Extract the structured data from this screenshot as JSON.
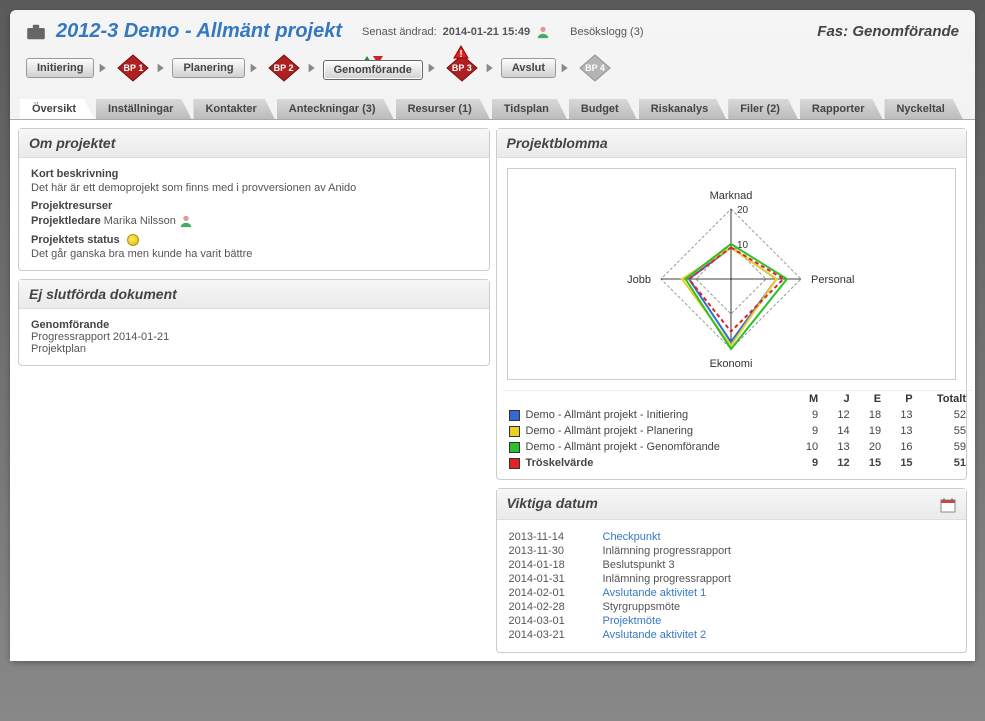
{
  "header": {
    "title": "2012-3 Demo - Allmänt projekt",
    "last_modified_label": "Senast ändrad:",
    "last_modified_value": "2014-01-21 15:49",
    "visit_log": "Besökslogg (3)",
    "phase_label": "Fas:",
    "phase_value": "Genomförande"
  },
  "workflow": {
    "stages": [
      "Initiering",
      "Planering",
      "Genomförande",
      "Avslut"
    ],
    "bps": [
      "BP 1",
      "BP 2",
      "BP 3",
      "BP 4"
    ]
  },
  "tabs": [
    "Översikt",
    "Inställningar",
    "Kontakter",
    "Anteckningar (3)",
    "Resurser (1)",
    "Tidsplan",
    "Budget",
    "Riskanalys",
    "Filer (2)",
    "Rapporter",
    "Nyckeltal"
  ],
  "about": {
    "title": "Om projektet",
    "desc_label": "Kort beskrivning",
    "desc_text": "Det här är ett demoprojekt som finns med i provversionen av Anido",
    "resources_label": "Projektresurser",
    "leader_label": "Projektledare",
    "leader_name": "Marika Nilsson",
    "status_label": "Projektets status",
    "status_text": "Det går ganska bra men kunde ha varit bättre"
  },
  "unfinished": {
    "title": "Ej slutförda dokument",
    "group": "Genomförande",
    "docs": [
      "Progressrapport 2014-01-21",
      "Projektplan"
    ]
  },
  "radar": {
    "title": "Projektblomma",
    "axes": [
      "Marknad",
      "Personal",
      "Ekonomi",
      "Jobb"
    ],
    "ticks": [
      "10",
      "20"
    ]
  },
  "legend": {
    "cols": [
      "M",
      "J",
      "E",
      "P",
      "Totalt"
    ],
    "rows": [
      {
        "color": "#2f6bd1",
        "label": "Demo - Allmänt projekt - Initiering",
        "vals": [
          "9",
          "12",
          "18",
          "13",
          "52"
        ],
        "bold": false
      },
      {
        "color": "#e9cf28",
        "label": "Demo - Allmänt projekt - Planering",
        "vals": [
          "9",
          "14",
          "19",
          "13",
          "55"
        ],
        "bold": false
      },
      {
        "color": "#2bbf2b",
        "label": "Demo - Allmänt projekt - Genomförande",
        "vals": [
          "10",
          "13",
          "20",
          "16",
          "59"
        ],
        "bold": false
      },
      {
        "color": "#e02424",
        "label": "Tröskelvärde",
        "vals": [
          "9",
          "12",
          "15",
          "15",
          "51"
        ],
        "bold": true
      }
    ]
  },
  "dates": {
    "title": "Viktiga datum",
    "items": [
      {
        "date": "2013-11-14",
        "label": "Checkpunkt",
        "link": true
      },
      {
        "date": "2013-11-30",
        "label": "Inlämning progressrapport",
        "link": false
      },
      {
        "date": "2014-01-18",
        "label": "Beslutspunkt 3",
        "link": false
      },
      {
        "date": "2014-01-31",
        "label": "Inlämning progressrapport",
        "link": false
      },
      {
        "date": "2014-02-01",
        "label": "Avslutande aktivitet 1",
        "link": true
      },
      {
        "date": "2014-02-28",
        "label": "Styrgruppsmöte",
        "link": false
      },
      {
        "date": "2014-03-01",
        "label": "Projektmöte",
        "link": true
      },
      {
        "date": "2014-03-21",
        "label": "Avslutande aktivitet 2",
        "link": true
      }
    ]
  },
  "chart_data": {
    "type": "radar",
    "axes": [
      "Marknad",
      "Jobb",
      "Ekonomi",
      "Personal"
    ],
    "max": 20,
    "series": [
      {
        "name": "Demo - Allmänt projekt - Initiering",
        "color": "#2f6bd1",
        "values": [
          9,
          12,
          18,
          13
        ]
      },
      {
        "name": "Demo - Allmänt projekt - Planering",
        "color": "#e9cf28",
        "values": [
          9,
          14,
          19,
          13
        ]
      },
      {
        "name": "Demo - Allmänt projekt - Genomförande",
        "color": "#2bbf2b",
        "values": [
          10,
          13,
          20,
          16
        ]
      },
      {
        "name": "Tröskelvärde",
        "color": "#e02424",
        "dashed": true,
        "values": [
          9,
          12,
          15,
          15
        ]
      }
    ]
  }
}
